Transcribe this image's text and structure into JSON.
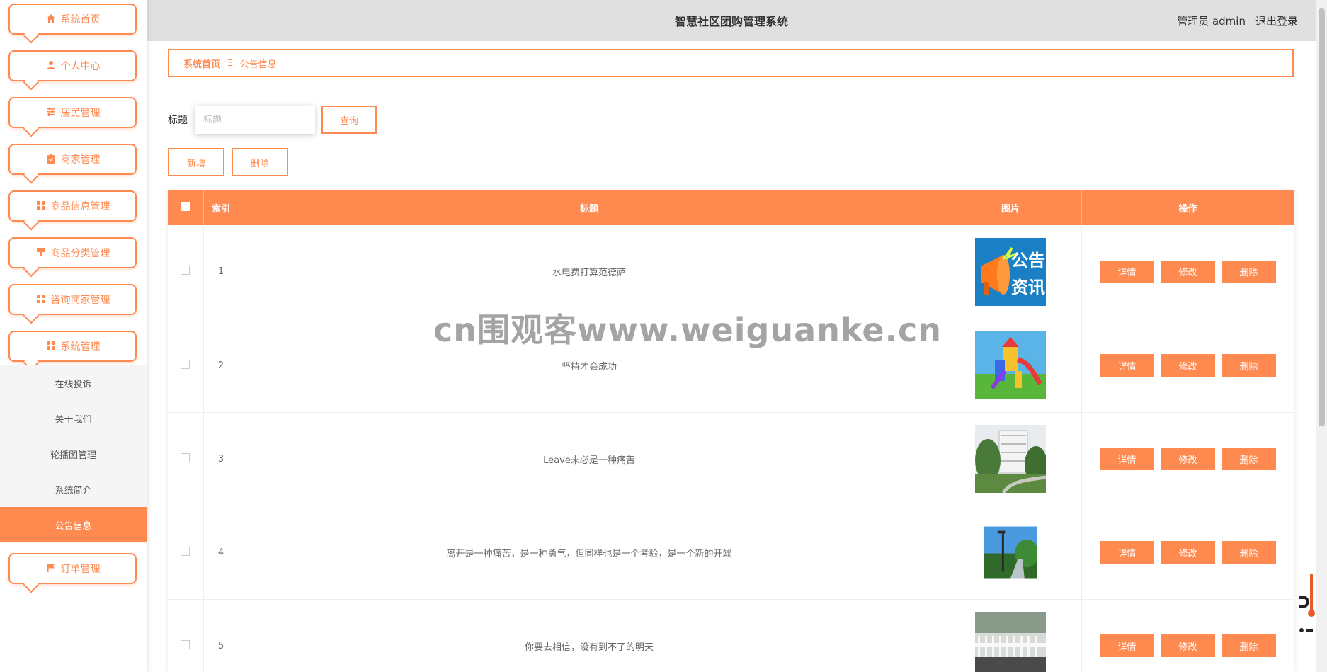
{
  "header": {
    "title": "智慧社区团购管理系统",
    "user": "管理员 admin",
    "logout": "退出登录"
  },
  "sidebar": {
    "items": [
      {
        "label": "系统首页",
        "icon": "home-icon"
      },
      {
        "label": "个人中心",
        "icon": "user-icon"
      },
      {
        "label": "居民管理",
        "icon": "sliders-icon"
      },
      {
        "label": "商家管理",
        "icon": "clipboard-icon"
      },
      {
        "label": "商品信息管理",
        "icon": "grid-icon"
      },
      {
        "label": "商品分类管理",
        "icon": "brush-icon"
      },
      {
        "label": "咨询商家管理",
        "icon": "grid-icon"
      },
      {
        "label": "系统管理",
        "icon": "grid-icon"
      },
      {
        "label": "订单管理",
        "icon": "flag-icon"
      }
    ],
    "sub_items": [
      "在线投诉",
      "关于我们",
      "轮播图管理",
      "系统简介",
      "公告信息"
    ],
    "active_sub": "公告信息"
  },
  "breadcrumb": {
    "home": "系统首页",
    "separator": "Ξ",
    "current": "公告信息"
  },
  "search": {
    "label": "标题",
    "placeholder": "标题",
    "value": "",
    "query_button": "查询"
  },
  "actions": {
    "add": "新增",
    "delete": "删除"
  },
  "table": {
    "headers": {
      "index": "索引",
      "title": "标题",
      "image": "图片",
      "ops": "操作"
    },
    "ops": {
      "detail": "详情",
      "edit": "修改",
      "delete": "删除"
    },
    "rows": [
      {
        "index": "1",
        "title": "水电费打算范德萨",
        "image_text": "公告资讯"
      },
      {
        "index": "2",
        "title": "坚持才会成功"
      },
      {
        "index": "3",
        "title": "Leave未必是一种痛苦"
      },
      {
        "index": "4",
        "title": "离开是一种痛苦，是一种勇气，但同样也是一个考验，是一个新的开端"
      },
      {
        "index": "5",
        "title": "你要去相信，没有到不了的明天"
      }
    ]
  },
  "watermark": "cn围观客www.weiguanke.cn",
  "colors": {
    "accent": "#ff8a50",
    "header_bg": "#e0e0e0"
  }
}
